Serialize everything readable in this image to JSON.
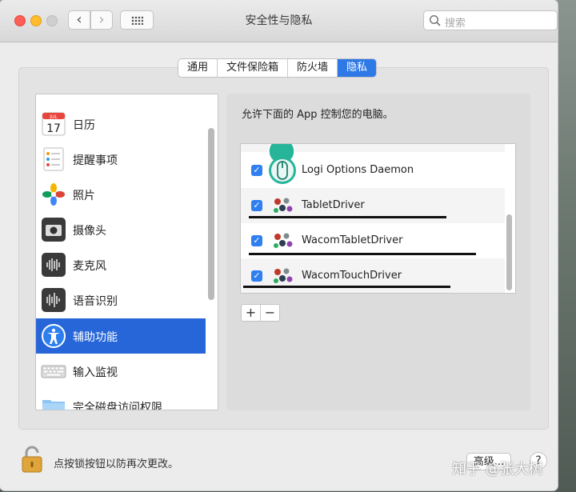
{
  "window": {
    "title": "安全性与隐私"
  },
  "toolbar": {
    "back": "‹",
    "forward": "›"
  },
  "search": {
    "placeholder": "搜索"
  },
  "tabs": [
    {
      "label": "通用",
      "active": false
    },
    {
      "label": "文件保险箱",
      "active": false
    },
    {
      "label": "防火墙",
      "active": false
    },
    {
      "label": "隐私",
      "active": true
    }
  ],
  "sidebar": {
    "items": [
      {
        "label": "日历",
        "icon": "calendar-icon",
        "calendar_month": "JUL",
        "calendar_day": "17"
      },
      {
        "label": "提醒事项",
        "icon": "reminders-icon"
      },
      {
        "label": "照片",
        "icon": "photos-icon"
      },
      {
        "label": "摄像头",
        "icon": "camera-icon"
      },
      {
        "label": "麦克风",
        "icon": "microphone-icon"
      },
      {
        "label": "语音识别",
        "icon": "speech-recognition-icon"
      },
      {
        "label": "辅助功能",
        "icon": "accessibility-icon",
        "selected": true
      },
      {
        "label": "输入监视",
        "icon": "keyboard-icon"
      },
      {
        "label": "完全磁盘访问权限",
        "icon": "folder-icon"
      }
    ]
  },
  "main": {
    "description": "允许下面的 App 控制您的电脑。",
    "apps": [
      {
        "name": "Logi Options Daemon",
        "checked": true,
        "icon": "logi-mouse-icon"
      },
      {
        "name": "TabletDriver",
        "checked": true,
        "icon": "wacom-driver-icon"
      },
      {
        "name": "WacomTabletDriver",
        "checked": true,
        "icon": "wacom-driver-icon"
      },
      {
        "name": "WacomTouchDriver",
        "checked": true,
        "icon": "wacom-driver-icon"
      }
    ],
    "add_label": "+",
    "remove_label": "−"
  },
  "footer": {
    "lock_text": "点按锁按钮以防再次更改。",
    "advanced_label": "高级...",
    "help_label": "?"
  },
  "watermark": "知乎 @张大树",
  "colors": {
    "accent": "#2f79e6",
    "selection": "#2766d9",
    "checkbox": "#2f7ff0"
  }
}
